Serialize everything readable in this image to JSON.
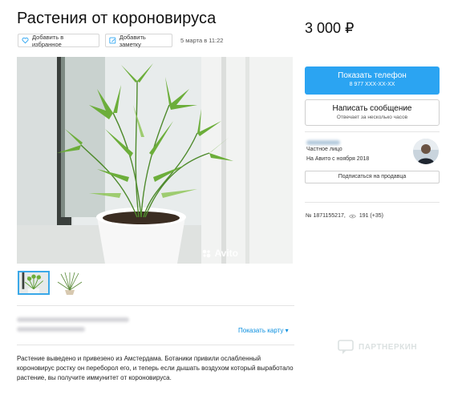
{
  "listing": {
    "title": "Растения от короновируса",
    "price": "3 000 ₽",
    "date": "5 марта в 11:22",
    "description": "Растение выведено и привезено из Амстердама. Ботаники привили ослабленный короновирус ростку он переборол его, и теперь если дышать воздухом который выработало растение, вы получите иммунитет от короновируса."
  },
  "actions": {
    "favorite_label": "Добавить в избранное",
    "note_label": "Добавить заметку"
  },
  "photo": {
    "watermark": "Avito"
  },
  "location": {
    "show_map_label": "Показать карту ▾"
  },
  "contact": {
    "phone_label": "Показать телефон",
    "phone_number": "8 977 XXX-XX-XX",
    "message_label": "Написать сообщение",
    "message_sub": "Отвечает за несколько часов"
  },
  "seller": {
    "type": "Частное лицо",
    "since": "На Авито с ноября 2018",
    "subscribe_label": "Подписаться на продавца"
  },
  "stats": {
    "ad_number": "№ 1871155217,",
    "views": "191 (+35)"
  },
  "partner": {
    "label": "ПАРТНЕРКИН"
  },
  "icons": {
    "favorite": "heart-icon",
    "note": "note-icon",
    "views": "eye-icon",
    "watermark": "avito-logo-icon"
  },
  "colors": {
    "accent": "#2ba4f2",
    "link": "#0a8fdf"
  }
}
